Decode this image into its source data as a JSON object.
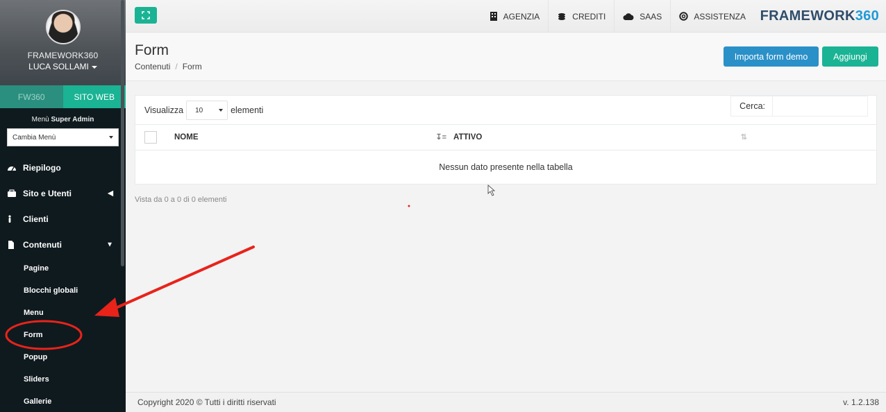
{
  "sidebar": {
    "profile": {
      "org": "FRAMEWORK360",
      "user": "LUCA SOLLAMI"
    },
    "switcher": {
      "fw": "FW360",
      "site": "SITO WEB"
    },
    "menu_label_prefix": "Menù",
    "menu_label_bold": "Super Admin",
    "menu_select": "Cambia Menù",
    "nav": [
      {
        "label": "Riepilogo",
        "icon": "dashboard-icon"
      },
      {
        "label": "Sito e Utenti",
        "icon": "users-icon"
      },
      {
        "label": "Clienti",
        "icon": "person-icon"
      },
      {
        "label": "Contenuti",
        "icon": "file-icon"
      }
    ],
    "sub": [
      "Pagine",
      "Blocchi globali",
      "Menu",
      "Form",
      "Popup",
      "Sliders",
      "Gallerie"
    ]
  },
  "topbar": {
    "items": [
      "AGENZIA",
      "CREDITI",
      "SAAS",
      "ASSISTENZA"
    ],
    "brand_main": "FRAMEWORK",
    "brand_num": "360"
  },
  "header": {
    "title": "Form",
    "breadcrumb_parent": "Contenuti",
    "breadcrumb_sep": "/",
    "breadcrumb_current": "Form",
    "import_button": "Importa form demo",
    "add_button": "Aggiungi"
  },
  "table": {
    "show_prefix": "Visualizza",
    "show_value": "10",
    "show_suffix": "elementi",
    "search_label": "Cerca:",
    "columns": [
      "NOME",
      "ATTIVO"
    ],
    "empty_message": "Nessun dato presente nella tabella",
    "info": "Vista da 0 a 0 di 0 elementi"
  },
  "footer": {
    "copyright": "Copyright 2020 © Tutti i diritti riservati",
    "version": "v. 1.2.138"
  },
  "colors": {
    "accent": "#1ab394",
    "primary": "#2a90c8",
    "sidebar": "#0f1a1f",
    "annotation": "#e8231a"
  }
}
